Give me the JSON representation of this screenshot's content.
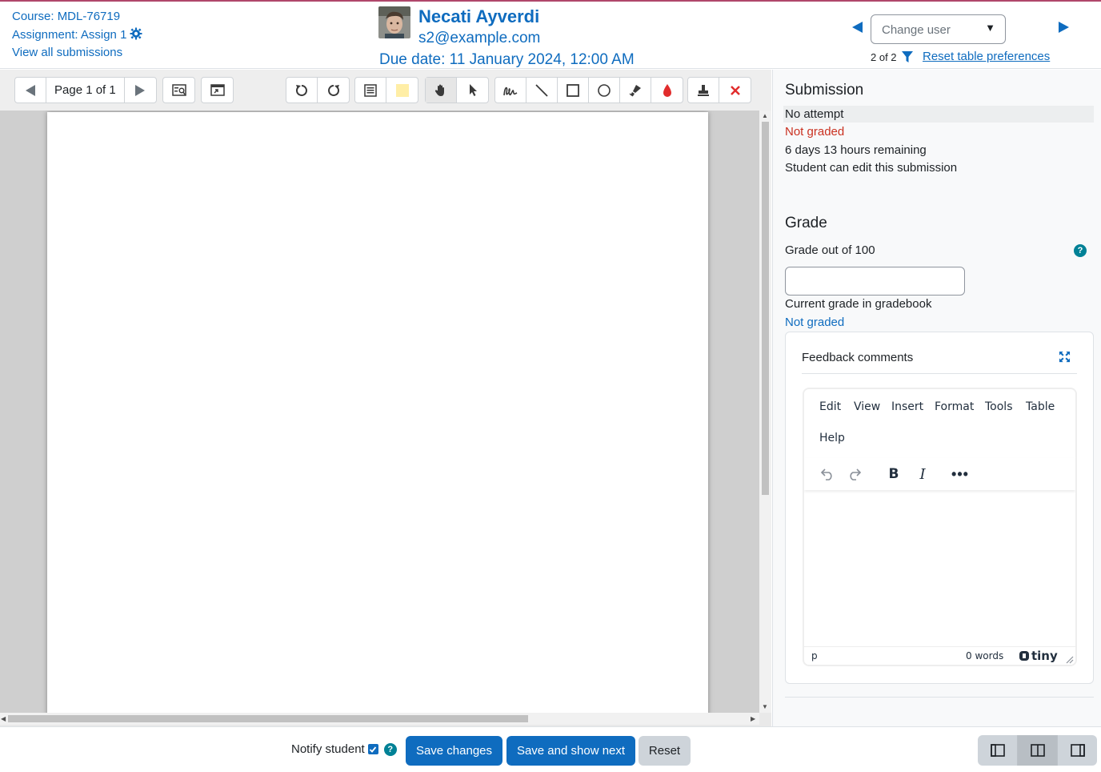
{
  "header": {
    "course_link": "Course: MDL-76719",
    "assignment_link": "Assignment: Assign 1",
    "view_all": "View all submissions",
    "user_name": "Necati Ayverdi",
    "user_email": "s2@example.com",
    "due_date": "Due date: 11 January 2024, 12:00 AM",
    "change_user_placeholder": "Change user",
    "user_count": "2 of 2",
    "reset_prefs": "Reset table preferences"
  },
  "pdf_toolbar": {
    "page_label": "Page 1 of 1"
  },
  "submission": {
    "title": "Submission",
    "attempt_status": "No attempt",
    "grading_status": "Not graded",
    "time_remaining": "6 days 13 hours remaining",
    "edit_status": "Student can edit this submission"
  },
  "grade": {
    "title": "Grade",
    "label": "Grade out of 100",
    "value": "",
    "current_label": "Current grade in gradebook",
    "current_value": "Not graded"
  },
  "feedback": {
    "title": "Feedback comments",
    "menu": [
      "Edit",
      "View",
      "Insert",
      "Format",
      "Tools",
      "Table",
      "Help"
    ],
    "status_path": "p",
    "word_count": "0 words",
    "brand": "tiny"
  },
  "footer": {
    "notify_label": "Notify student",
    "notify_checked": true,
    "save_label": "Save changes",
    "save_next_label": "Save and show next",
    "reset_label": "Reset"
  },
  "colors": {
    "link": "#0f6cbf",
    "danger": "#ca3120",
    "help": "#008196",
    "accent_line": "#b0476b"
  }
}
